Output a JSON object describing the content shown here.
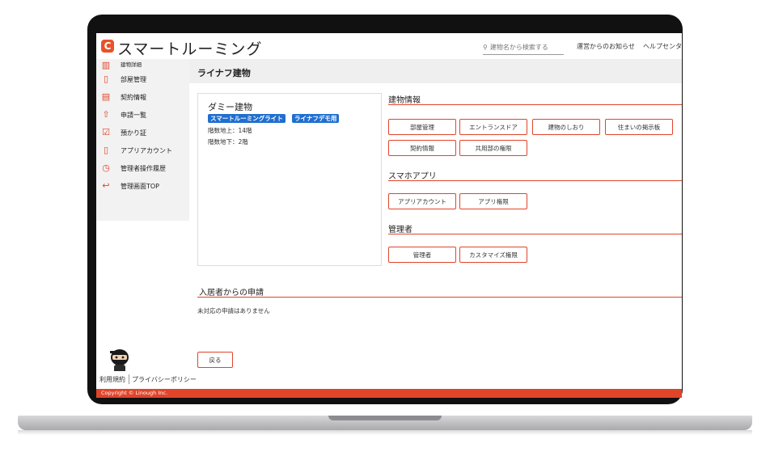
{
  "brand": {
    "name": "スマートルーミング",
    "accent": "#e0452a",
    "tag_color": "#1f6fd0"
  },
  "header": {
    "search_placeholder": "建物名から検索する",
    "notice_link": "運営からのお知らせ",
    "help_link": "ヘルプセンター"
  },
  "sidebar": {
    "items": [
      {
        "label": "建物詳細",
        "icon": "building-icon"
      },
      {
        "label": "部屋管理",
        "icon": "door-icon"
      },
      {
        "label": "契約情報",
        "icon": "document-icon"
      },
      {
        "label": "申請一覧",
        "icon": "upload-doc-icon"
      },
      {
        "label": "預かり証",
        "icon": "check-doc-icon"
      },
      {
        "label": "アプリアカウント",
        "icon": "smartphone-icon"
      },
      {
        "label": "管理者操作履歴",
        "icon": "clock-icon"
      },
      {
        "label": "管理画面TOP",
        "icon": "return-icon"
      }
    ]
  },
  "page": {
    "title": "ライナフ建物",
    "building": {
      "name": "ダミー建物",
      "tags": [
        "スマートルーミングライト",
        "ライナフデモ用"
      ],
      "floors_above": "階数地上：14階",
      "floors_below": "階数地下：2階"
    },
    "sections": {
      "building_info": {
        "title": "建物情報",
        "buttons": [
          "部屋管理",
          "エントランスドア",
          "建物のしおり",
          "住まいの掲示板",
          "契約情報",
          "共用部の権限"
        ]
      },
      "smartphone_app": {
        "title": "スマホアプリ",
        "buttons": [
          "アプリアカウント",
          "アプリ権限"
        ]
      },
      "admin": {
        "title": "管理者",
        "buttons": [
          "管理者",
          "カスタマイズ権限"
        ]
      }
    },
    "requests": {
      "title": "入居者からの申請",
      "empty_text": "未対応の申請はありません"
    },
    "back_label": "戻る"
  },
  "footer": {
    "terms": "利用規約",
    "privacy": "プライバシーポリシー",
    "copyright": "Copyright © Linough Inc."
  }
}
